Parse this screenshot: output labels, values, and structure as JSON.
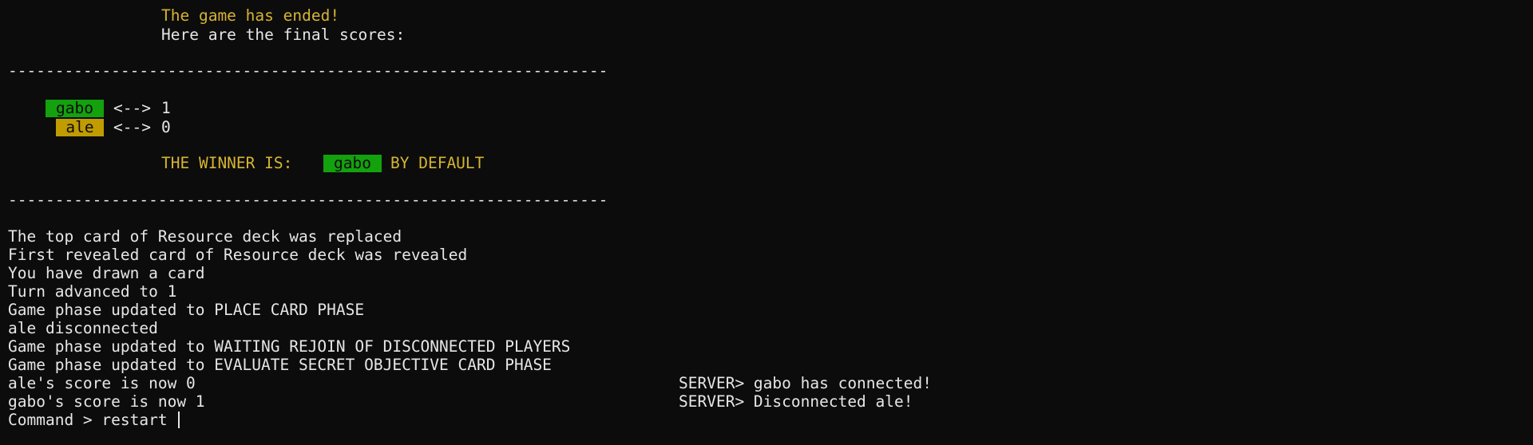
{
  "header": {
    "ended": "The game has ended!",
    "final_scores": "Here are the final scores:"
  },
  "separator": "----------------------------------------------------------------",
  "scores": [
    {
      "name": "gabo",
      "arrow": "<-->",
      "score": "1",
      "badge_color": "#13a10e"
    },
    {
      "name": "ale",
      "arrow": "<-->",
      "score": "0",
      "badge_color": "#c19c00"
    }
  ],
  "winner": {
    "prefix": "THE WINNER IS:",
    "name": "gabo",
    "suffix": "BY DEFAULT"
  },
  "log": [
    "The top card of Resource deck was replaced",
    "First revealed card of Resource deck was revealed",
    "You have drawn a card",
    "Turn advanced to 1",
    "Game phase updated to PLACE CARD PHASE",
    "ale disconnected",
    "Game phase updated to WAITING REJOIN OF DISCONNECTED PLAYERS",
    "Game phase updated to EVALUATE SECRET OBJECTIVE CARD PHASE",
    "ale's score is now 0",
    "gabo's score is now 1"
  ],
  "server": [
    "SERVER> gabo has connected!",
    "SERVER> Disconnected ale!"
  ],
  "prompt": {
    "label": "Command > ",
    "value": "restart "
  },
  "colors": {
    "background": "#0c0c0c",
    "foreground": "#e6e6e6",
    "highlight_yellow": "#d6b432",
    "badge_green": "#13a10e",
    "badge_yellow": "#c19c00"
  }
}
